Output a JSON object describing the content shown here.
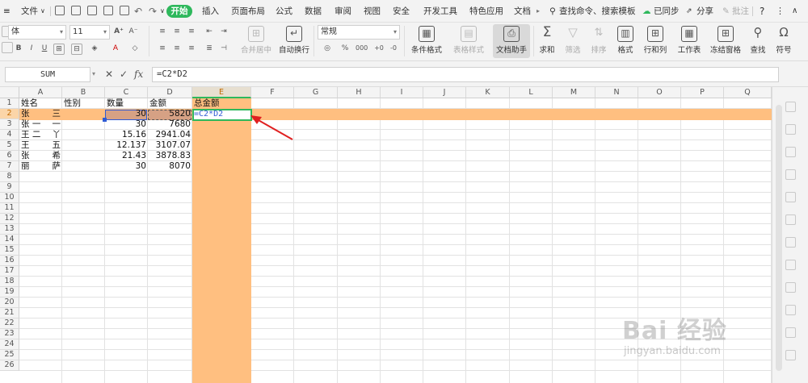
{
  "menu": {
    "file": "文件",
    "tabs": [
      "开始",
      "插入",
      "页面布局",
      "公式",
      "数据",
      "审阅",
      "视图",
      "安全",
      "开发工具",
      "特色应用",
      "文档"
    ],
    "search": "查找命令、搜索模板",
    "sync": "已同步",
    "share": "分享",
    "comment": "批注",
    "help": "?"
  },
  "ribbon": {
    "font_name": "体",
    "font_size": "11",
    "merge_center": "合并居中",
    "wrap_text": "自动换行",
    "number_format": "常规",
    "conditional_format": "条件格式",
    "table_style": "表格样式",
    "doc_helper": "文档助手",
    "sum": "求和",
    "filter": "筛选",
    "sort": "排序",
    "format": "格式",
    "row_col": "行和列",
    "worksheet": "工作表",
    "freeze": "冻结窗格",
    "find": "查找",
    "symbol": "符号"
  },
  "formula_bar": {
    "name_box": "SUM",
    "cancel_icon": "✕",
    "confirm_icon": "✓",
    "fx_label": "fx",
    "formula": "=C2*D2"
  },
  "sheet": {
    "columns": [
      "A",
      "B",
      "C",
      "D",
      "E",
      "F",
      "G",
      "H",
      "I",
      "J",
      "K",
      "L",
      "M",
      "N",
      "O",
      "P",
      "Q"
    ],
    "selected_column": "E",
    "selected_row": 2,
    "header_row": [
      "姓名",
      "性别",
      "数量",
      "金额",
      "总金额"
    ],
    "rows": [
      {
        "name_a": "张",
        "name_b": "三",
        "qty": "30",
        "amount": "5820",
        "total": "=C2*D2"
      },
      {
        "name_a": "张 一",
        "name_b": "一",
        "qty": "30",
        "amount": "7680",
        "total": ""
      },
      {
        "name_a": "王 二",
        "name_b": "丫",
        "qty": "15.16",
        "amount": "2941.04",
        "total": ""
      },
      {
        "name_a": "王",
        "name_b": "五",
        "qty": "12.137",
        "amount": "3107.07",
        "total": ""
      },
      {
        "name_a": "张",
        "name_b": "希",
        "qty": "21.43",
        "amount": "3878.83",
        "total": ""
      },
      {
        "name_a": "丽",
        "name_b": "萨",
        "qty": "30",
        "amount": "8070",
        "total": ""
      }
    ],
    "row_numbers": [
      "1",
      "2",
      "3",
      "4",
      "5",
      "6",
      "7",
      "8",
      "9",
      "10",
      "11",
      "12",
      "13",
      "14",
      "15",
      "16",
      "17",
      "18",
      "19",
      "20",
      "21",
      "22",
      "23",
      "24",
      "25",
      "26"
    ]
  },
  "watermark": {
    "logo": "Bai 经验",
    "url": "jingyan.baidu.com"
  },
  "colors": {
    "accent_green": "#2eb85c",
    "highlight_orange": "#ffbf80",
    "ref_c2_fill": "#d6a184",
    "arrow_red": "#e02020",
    "ref_blue": "#2f5bd4"
  }
}
